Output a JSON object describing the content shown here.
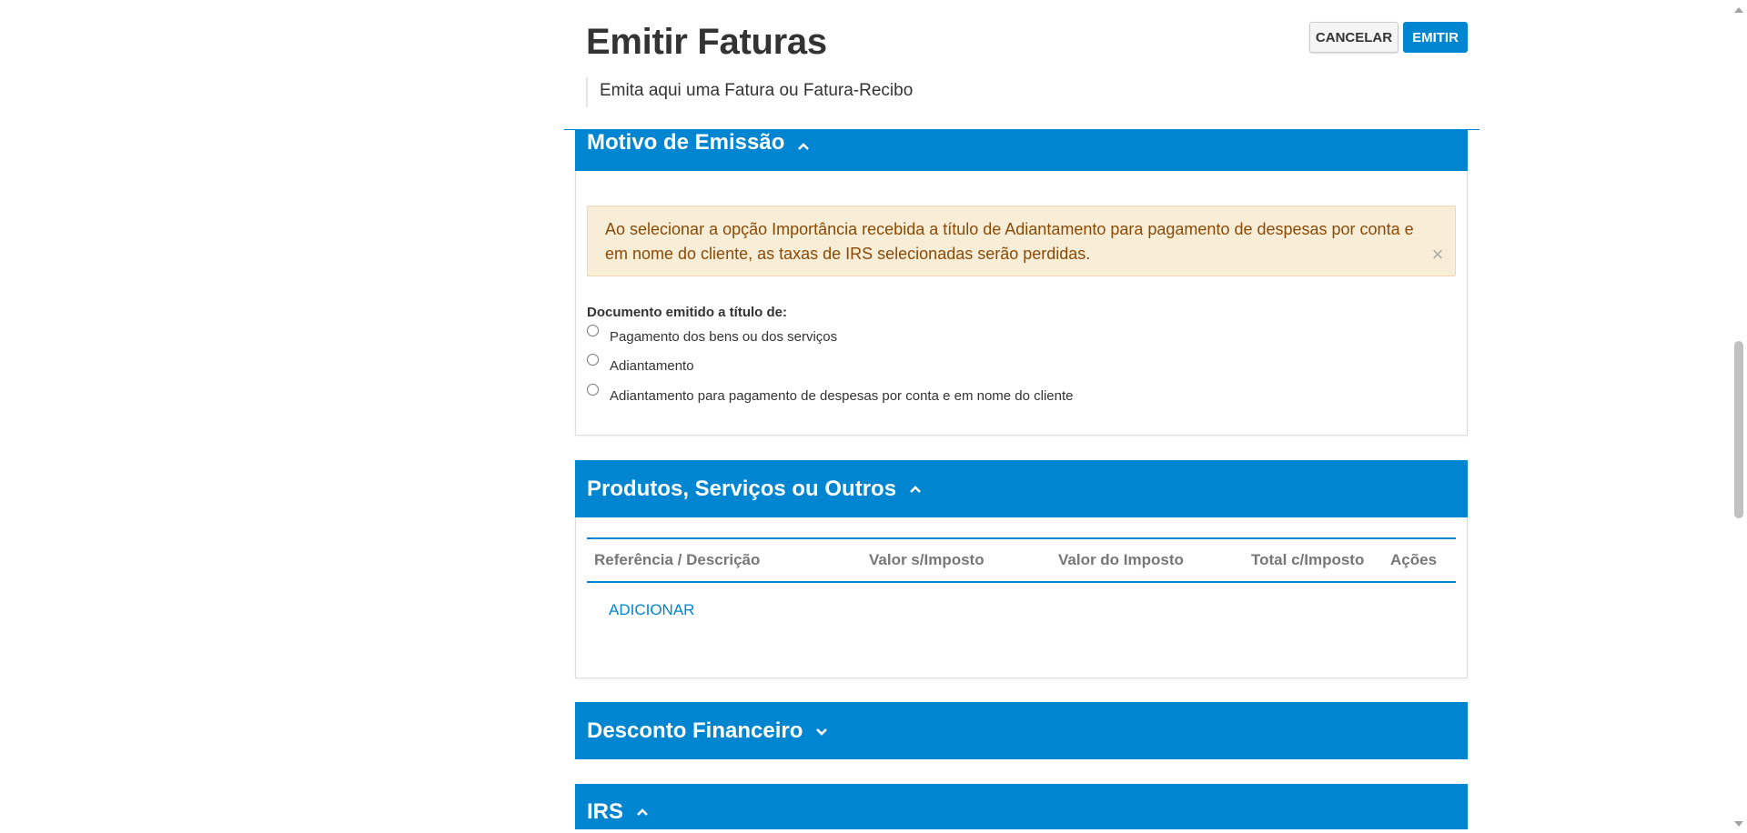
{
  "header": {
    "title": "Emitir Faturas",
    "subtitle": "Emita aqui uma Fatura ou Fatura-Recibo",
    "cancel_label": "CANCELAR",
    "emit_label": "EMITIR"
  },
  "sections": {
    "motivo": {
      "title": "Motivo de Emissão",
      "expanded": true,
      "alert_text": "Ao selecionar a opção Importância recebida a título de Adiantamento para pagamento de despesas por conta e em nome do cliente, as taxas de IRS selecionadas serão perdidas.",
      "alert_close": "×",
      "field_label": "Documento emitido a título de:",
      "options": [
        "Pagamento dos bens ou dos serviços",
        "Adiantamento",
        "Adiantamento para pagamento de despesas por conta e em nome do cliente"
      ]
    },
    "produtos": {
      "title": "Produtos, Serviços ou Outros",
      "expanded": true,
      "columns": [
        "Referência / Descrição",
        "Valor s/Imposto",
        "Valor do Imposto",
        "Total c/Imposto",
        "Ações"
      ],
      "add_label": "ADICIONAR"
    },
    "desconto": {
      "title": "Desconto Financeiro",
      "expanded": false
    },
    "irs": {
      "title": "IRS",
      "expanded": true
    }
  },
  "icons": {
    "collapse": "chevron-up-icon",
    "expand": "chevron-down-icon",
    "close": "close-icon"
  },
  "colors": {
    "primary": "#0085d0",
    "alert_bg": "#f8eed8",
    "alert_text": "#8a4a06"
  }
}
